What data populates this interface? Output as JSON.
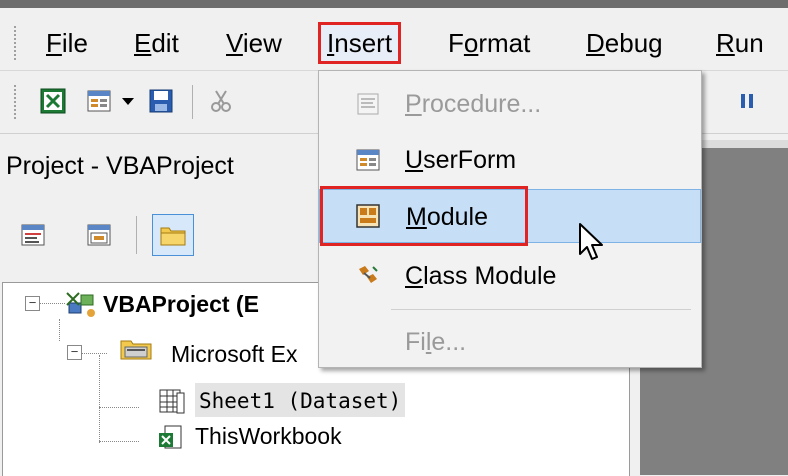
{
  "menubar": {
    "items": [
      {
        "id": "file",
        "pre": "",
        "key": "F",
        "post": "ile"
      },
      {
        "id": "edit",
        "pre": "",
        "key": "E",
        "post": "dit"
      },
      {
        "id": "view",
        "pre": "",
        "key": "V",
        "post": "iew"
      },
      {
        "id": "insert",
        "pre": "",
        "key": "I",
        "post": "nsert"
      },
      {
        "id": "format",
        "pre": "F",
        "key": "o",
        "post": "rmat"
      },
      {
        "id": "debug",
        "pre": "",
        "key": "D",
        "post": "ebug"
      },
      {
        "id": "run",
        "pre": "",
        "key": "R",
        "post": "un"
      }
    ]
  },
  "project_panel": {
    "title": "Project - VBAProject"
  },
  "tree": {
    "root": "VBAProject (E",
    "folder": "Microsoft Ex",
    "sheet1": "Sheet1 (Dataset)",
    "workbook": "ThisWorkbook"
  },
  "insert_menu": {
    "procedure": {
      "key": "P",
      "rest": "rocedure..."
    },
    "userform": {
      "key": "U",
      "rest": "serForm"
    },
    "module": {
      "key": "M",
      "rest": "odule"
    },
    "class_module": {
      "key": "C",
      "rest": "lass Module"
    },
    "file": {
      "pre": "Fi",
      "key": "l",
      "post": "e..."
    }
  },
  "colors": {
    "highlight_red": "#e02424",
    "hover_blue": "#c6dff6"
  }
}
